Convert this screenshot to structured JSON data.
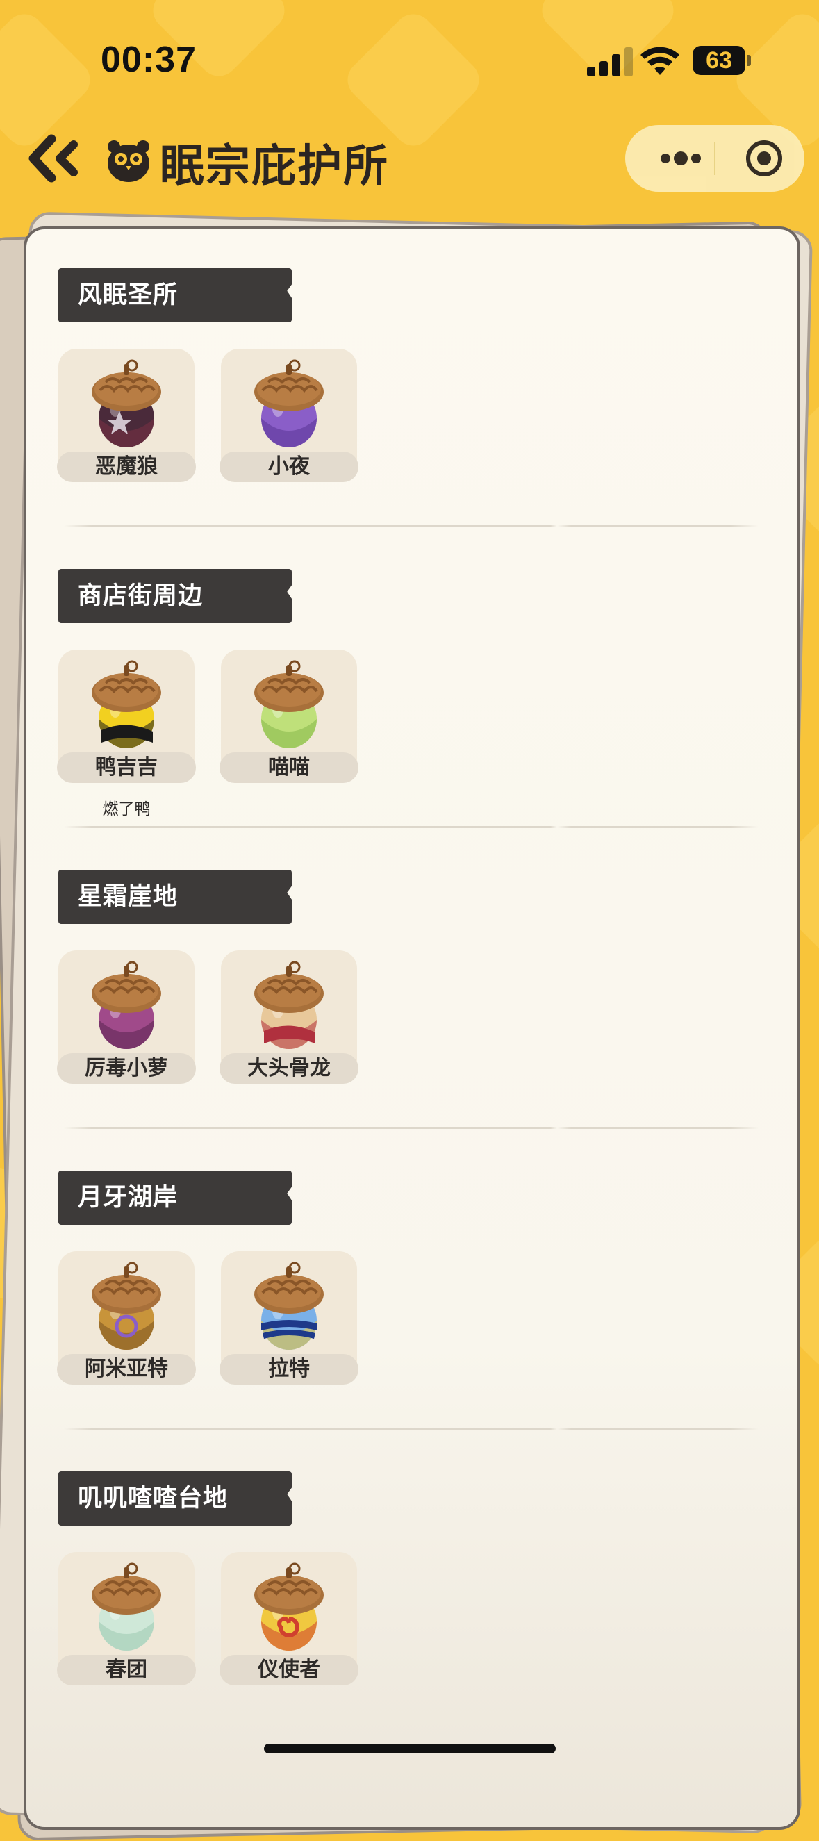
{
  "status_bar": {
    "time": "00:37",
    "battery": "63"
  },
  "header": {
    "title": "眠宗庇护所"
  },
  "sections": [
    {
      "title": "风眠圣所",
      "items": [
        {
          "name": "恶魔狼",
          "sub": "",
          "colors": [
            "#4a2a3a",
            "#7a3044"
          ],
          "mark": "star"
        },
        {
          "name": "小夜",
          "sub": "",
          "colors": [
            "#8a5ec8",
            "#5a3496"
          ],
          "mark": ""
        }
      ]
    },
    {
      "title": "商店街周边",
      "items": [
        {
          "name": "鸭吉吉",
          "sub": "燃了鸭",
          "colors": [
            "#f2d020",
            "#1a1a1a"
          ],
          "mark": "stripe"
        },
        {
          "name": "喵喵",
          "sub": "",
          "colors": [
            "#bfe07a",
            "#86b84a"
          ],
          "mark": ""
        }
      ]
    },
    {
      "title": "星霜崖地",
      "items": [
        {
          "name": "厉毒小萝",
          "sub": "",
          "colors": [
            "#a04a8a",
            "#5a2450"
          ],
          "mark": ""
        },
        {
          "name": "大头骨龙",
          "sub": "",
          "colors": [
            "#e8c89a",
            "#b0303e"
          ],
          "mark": "stripe"
        }
      ]
    },
    {
      "title": "月牙湖岸",
      "items": [
        {
          "name": "阿米亚特",
          "sub": "",
          "colors": [
            "#c8943a",
            "#7a5220"
          ],
          "mark": "ring"
        },
        {
          "name": "拉特",
          "sub": "",
          "colors": [
            "#7ab0e8",
            "#f2c830"
          ],
          "mark": "band"
        }
      ]
    },
    {
      "title": "叽叽喳喳台地",
      "items": [
        {
          "name": "春团",
          "sub": "",
          "colors": [
            "#cfe8d8",
            "#9cc8b0"
          ],
          "mark": ""
        },
        {
          "name": "仪使者",
          "sub": "",
          "colors": [
            "#f0c840",
            "#d0402e"
          ],
          "mark": "spiral"
        }
      ]
    }
  ]
}
